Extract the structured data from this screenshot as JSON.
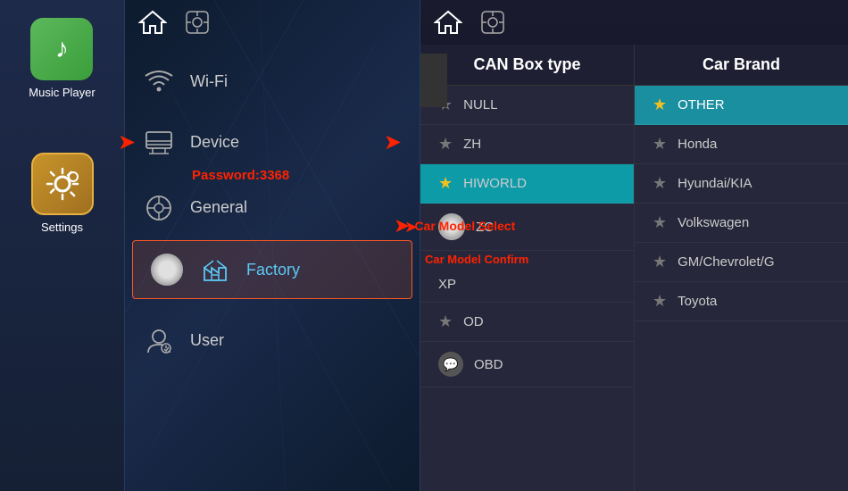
{
  "sidebar": {
    "apps": [
      {
        "id": "music-player",
        "label": "Music Player",
        "icon": "music-note-icon"
      },
      {
        "id": "settings",
        "label": "Settings",
        "icon": "gear-icon",
        "active": true
      }
    ]
  },
  "center_panel": {
    "menu_items": [
      {
        "id": "wifi",
        "label": "Wi-Fi",
        "icon": "wifi-icon"
      },
      {
        "id": "device",
        "label": "Device",
        "icon": "device-icon",
        "has_arrow": true
      },
      {
        "id": "general",
        "label": "General",
        "icon": "general-icon"
      },
      {
        "id": "factory",
        "label": "Factory",
        "icon": "factory-icon",
        "active": true
      },
      {
        "id": "user",
        "label": "User",
        "icon": "user-icon"
      }
    ],
    "password_label": "Password:3368"
  },
  "can_box": {
    "column1_header": "CAN Box type",
    "column2_header": "Car Brand",
    "column1_items": [
      {
        "id": "null",
        "label": "NULL",
        "star": "gray"
      },
      {
        "id": "zh",
        "label": "ZH",
        "star": "gray"
      },
      {
        "id": "hiworld",
        "label": "HIWORLD",
        "star": "gold",
        "selected": true
      },
      {
        "id": "zc",
        "label": "ZC",
        "star": "none",
        "toggle": true
      },
      {
        "id": "xp",
        "label": "XP",
        "star": "none"
      },
      {
        "id": "od",
        "label": "OD",
        "star": "gray"
      },
      {
        "id": "obd",
        "label": "OBD",
        "star": "none",
        "chat": true
      }
    ],
    "column2_items": [
      {
        "id": "other",
        "label": "OTHER",
        "star": "gold",
        "selected": true
      },
      {
        "id": "honda",
        "label": "Honda",
        "star": "gray"
      },
      {
        "id": "hyundai",
        "label": "Hyundai/KIA",
        "star": "gray"
      },
      {
        "id": "volkswagen",
        "label": "Volkswagen",
        "star": "gray"
      },
      {
        "id": "gm",
        "label": "GM/Chevrolet/G",
        "star": "gray"
      },
      {
        "id": "toyota",
        "label": "Toyota",
        "star": "gray"
      }
    ]
  },
  "annotations": {
    "password": "Password:3368",
    "car_model_select": "Car Model Select",
    "car_model_confirm": "Car Model Confirm"
  }
}
